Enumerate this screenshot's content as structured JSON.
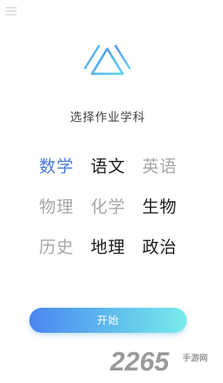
{
  "prompt": "选择作业学科",
  "subjects": [
    {
      "label": "数学",
      "state": "selected"
    },
    {
      "label": "语文",
      "state": "active"
    },
    {
      "label": "英语",
      "state": "inactive"
    },
    {
      "label": "物理",
      "state": "inactive"
    },
    {
      "label": "化学",
      "state": "inactive"
    },
    {
      "label": "生物",
      "state": "active"
    },
    {
      "label": "历史",
      "state": "inactive"
    },
    {
      "label": "地理",
      "state": "active"
    },
    {
      "label": "政治",
      "state": "active"
    }
  ],
  "start_label": "开始",
  "watermark": {
    "number": "2265",
    "text": "手游网"
  },
  "colors": {
    "selected": "#4a7ddc",
    "active": "#1f1f1f",
    "inactive": "#a8a8a8",
    "gradient_start": "#4b86f2",
    "gradient_end": "#79ecec"
  },
  "icons": {
    "menu": "hamburger-menu-icon",
    "logo": "triangle-logo-icon"
  }
}
